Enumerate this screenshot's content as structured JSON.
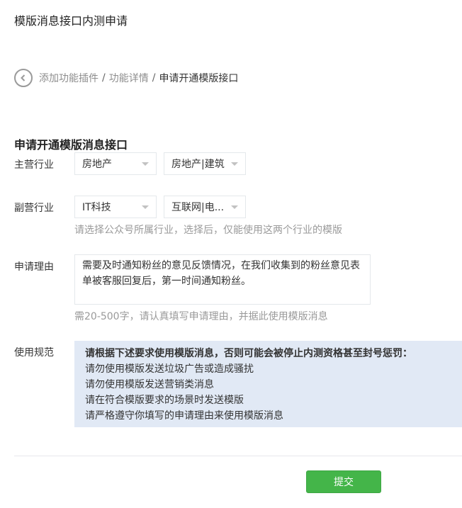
{
  "page_title": "模版消息接口内测申请",
  "breadcrumb": {
    "items": [
      "添加功能插件",
      "功能详情"
    ],
    "separator": "/",
    "current": "申请开通模版接口"
  },
  "form": {
    "title": "申请开通模版消息接口",
    "primary_industry": {
      "label": "主营行业",
      "category": "房地产",
      "subcategory": "房地产|建筑"
    },
    "secondary_industry": {
      "label": "副营行业",
      "category": "IT科技",
      "subcategory": "互联网|电..."
    },
    "industry_hint": "请选择公众号所属行业，选择后，仅能使用这两个行业的模版",
    "reason": {
      "label": "申请理由",
      "value": "需要及时通知粉丝的意见反馈情况，在我们收集到的粉丝意见表单被客服回复后，第一时间通知粉丝。",
      "hint": "需20-500字，请认真填写申请理由，并据此使用模版消息"
    },
    "rules": {
      "label": "使用规范",
      "heading": "请根据下述要求使用模版消息，否则可能会被停止内测资格甚至封号惩罚：",
      "items": [
        "请勿使用模版发送垃圾广告或造成骚扰",
        "请勿使用模版发送营销类消息",
        "请在符合模版要求的场景时发送模版",
        "请严格遵守你填写的申请理由来使用模版消息"
      ]
    },
    "submit_label": "提交"
  },
  "colors": {
    "accent": "#44b549",
    "rules_bg": "#e1e9f5",
    "hint": "#9a9a9a"
  }
}
